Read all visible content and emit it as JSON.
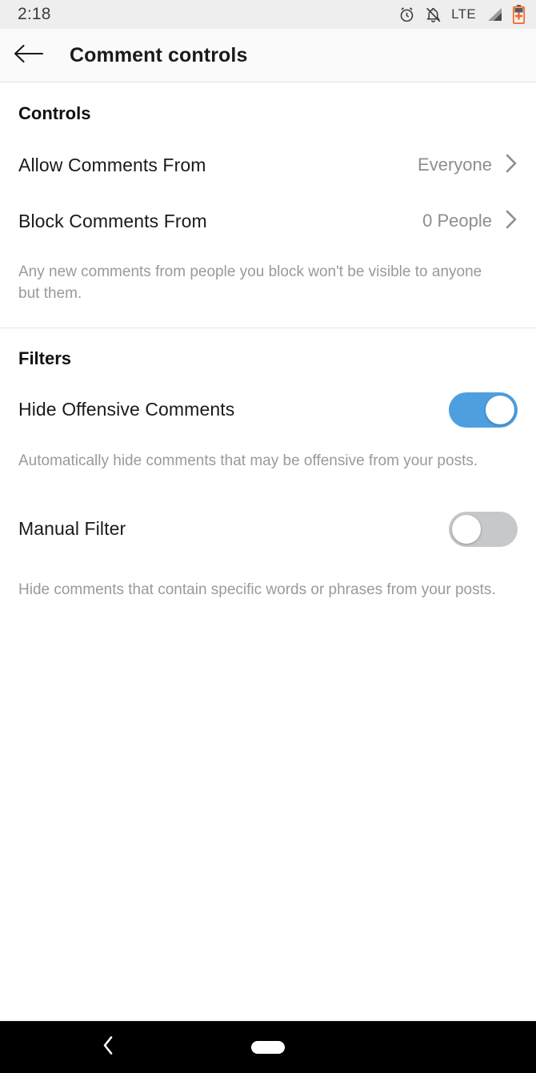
{
  "status_bar": {
    "time": "2:18",
    "network": "LTE",
    "icons": [
      "alarm-icon",
      "notifications-off-icon",
      "signal-icon",
      "battery-charging-icon"
    ]
  },
  "app_bar": {
    "back_label": "Back",
    "title": "Comment controls"
  },
  "sections": {
    "controls": {
      "title": "Controls",
      "rows": [
        {
          "label": "Allow Comments From",
          "value": "Everyone"
        },
        {
          "label": "Block Comments From",
          "value": "0 People"
        }
      ],
      "helper": "Any new comments from people you block won't be visible to anyone but them."
    },
    "filters": {
      "title": "Filters",
      "rows": [
        {
          "label": "Hide Offensive Comments",
          "state": "on",
          "helper": "Automatically hide comments that may be offensive from your posts."
        },
        {
          "label": "Manual Filter",
          "state": "off",
          "helper": "Hide comments that contain specific words or phrases from your posts."
        }
      ]
    }
  },
  "nav_bar": {
    "back_label": "Back",
    "home_label": "Home"
  },
  "colors": {
    "toggle_on": "#4e9fe0",
    "toggle_off": "#c6c9cc",
    "battery": "#f4662a",
    "status_bar_bg": "#eeeeee",
    "app_bar_bg": "#fafafa"
  }
}
